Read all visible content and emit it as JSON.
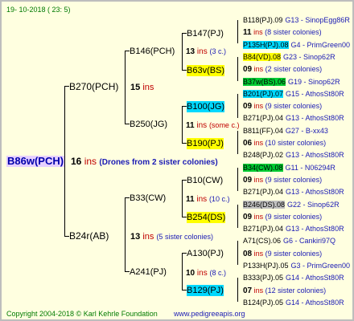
{
  "header": {
    "date": "19- 10-2018 ( 23: 5)"
  },
  "footer": {
    "copyright": "Copyright 2004-2018 © Karl Kehrle Foundation",
    "website": "www.pedigreeapis.org"
  },
  "root": {
    "name": "B86w(PCH)",
    "ins": "16",
    "ins_label": "ins",
    "note": "(Drones from 2 sister colonies)"
  },
  "gen1": [
    {
      "name": "B270(PCH)",
      "ins": "15",
      "ins_label": "ins"
    },
    {
      "name": "B24r(AB)",
      "ins": "13",
      "ins_label": "ins",
      "note": "(5 sister colonies)"
    }
  ],
  "gen2": [
    {
      "name": "B146(PCH)",
      "ins": "13",
      "ins_label": "ins",
      "note": "(3 c.)"
    },
    {
      "name": "B250(JG)",
      "ins": "11",
      "ins_label": "ins",
      "note": "(some c.)"
    },
    {
      "name": "B33(CW)",
      "ins": "11",
      "ins_label": "ins",
      "note": "(10 c.)"
    },
    {
      "name": "A241(PJ)",
      "ins": "10",
      "ins_label": "ins",
      "note": "(8 c.)"
    }
  ],
  "gen3": [
    {
      "name": "B147(PJ)"
    },
    {
      "name": "B63v(BS)"
    },
    {
      "name": "B100(JG)"
    },
    {
      "name": "B190(PJ)"
    },
    {
      "name": "B10(CW)"
    },
    {
      "name": "B254(DS)"
    },
    {
      "name": "A130(PJ)"
    },
    {
      "name": "B129(PJ)"
    }
  ],
  "gen4": [
    {
      "name": "B118(PJ).09",
      "code": "G13 - SinopEgg86R"
    },
    {
      "name": "11",
      "ins_label": "ins",
      "note": "(8 sister colonies)"
    },
    {
      "name": "P135H(PJ).08",
      "code": "G4 - PrimGreen00"
    },
    {
      "name": "B84(VD).08",
      "code": "G23 - Sinop62R"
    },
    {
      "name": "09",
      "ins_label": "ins",
      "note": "(2 sister colonies)"
    },
    {
      "name": "B37w(BS).06",
      "code": "G19 - Sinop62R"
    },
    {
      "name": "B201(PJ).07",
      "code": "G15 - AthosSt80R"
    },
    {
      "name": "09",
      "ins_label": "ins",
      "note": "(9 sister colonies)"
    },
    {
      "name": "B271(PJ).04",
      "code": "G13 - AthosSt80R"
    },
    {
      "name": "B811(FF).04",
      "code": "G27 - B-xx43"
    },
    {
      "name": "06",
      "ins_label": "ins",
      "note": "(10 sister colonies)"
    },
    {
      "name": "B248(PJ).02",
      "code": "G13 - AthosSt80R"
    },
    {
      "name": "B34(CW).08",
      "code": "G11 - N06294R"
    },
    {
      "name": "09",
      "ins_label": "ins",
      "note": "(9 sister colonies)"
    },
    {
      "name": "B271(PJ).04",
      "code": "G13 - AthosSt80R"
    },
    {
      "name": "B246(DS).08",
      "code": "G22 - Sinop62R"
    },
    {
      "name": "09",
      "ins_label": "ins",
      "note": "(9 sister colonies)"
    },
    {
      "name": "B271(PJ).04",
      "code": "G13 - AthosSt80R"
    },
    {
      "name": "A71(CS).06",
      "code": "G6 - Cankiri97Q"
    },
    {
      "name": "08",
      "ins_label": "ins",
      "note": "(9 sister colonies)"
    },
    {
      "name": "P133H(PJ).05",
      "code": "G3 - PrimGreen00"
    },
    {
      "name": "B333(PJ).05",
      "code": "G14 - AthosSt80R"
    },
    {
      "name": "07",
      "ins_label": "ins",
      "note": "(12 sister colonies)"
    },
    {
      "name": "B124(PJ).05",
      "code": "G14 - AthosSt80R"
    }
  ]
}
